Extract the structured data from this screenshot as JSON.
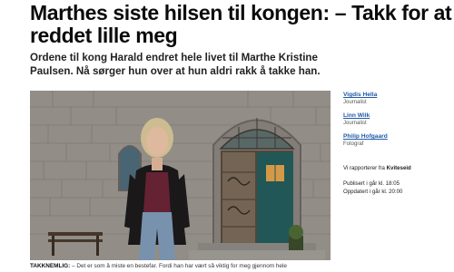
{
  "article": {
    "headline_line1": "Marthes siste hilsen til kongen: – Takk for at du",
    "headline_line2": "reddet lille meg",
    "lead_line1": "Ordene til kong Harald endret hele livet til Marthe Kristine",
    "lead_line2": "Paulsen. Nå sørger hun over at hun aldri rakk å takke han.",
    "caption_label": "TAKKNEMLIG:",
    "caption_text": " – Det er som å miste en bestefar. Fordi han har vært så viktig for meg gjennom hele"
  },
  "authors": [
    {
      "name": "Vigdis Hella",
      "role": "Journalist"
    },
    {
      "name": "Linn Wilk",
      "role": "Journalist"
    },
    {
      "name": "Philip Hofgaard",
      "role": "Fotograf"
    }
  ],
  "reported_from": {
    "prefix": "Vi rapporterer fra ",
    "place": "Kviteseid"
  },
  "published": "Publisert i går kl. 18:05",
  "updated": "Oppdatert i går kl. 20:00",
  "colors": {
    "link": "#1f5aa8",
    "headline": "#0b0b0b"
  }
}
